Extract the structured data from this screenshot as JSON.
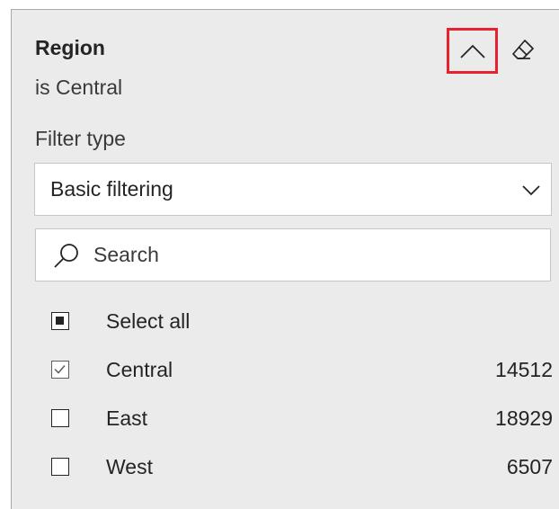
{
  "filter_card": {
    "title": "Region",
    "subtitle": "is Central",
    "filter_type_label": "Filter type",
    "filter_type_value": "Basic filtering",
    "search_placeholder": "Search",
    "select_all_label": "Select all",
    "select_all_state": "partial",
    "items": [
      {
        "label": "Central",
        "count": "14512",
        "checked": true
      },
      {
        "label": "East",
        "count": "18929",
        "checked": false
      },
      {
        "label": "West",
        "count": "6507",
        "checked": false
      }
    ]
  },
  "icons": {
    "collapse": "chevron-up-icon",
    "clear": "eraser-icon",
    "dropdown": "chevron-down-icon",
    "search": "search-icon"
  },
  "colors": {
    "highlight": "#e8212e",
    "card_background": "#ebebeb",
    "text": "#252423"
  }
}
